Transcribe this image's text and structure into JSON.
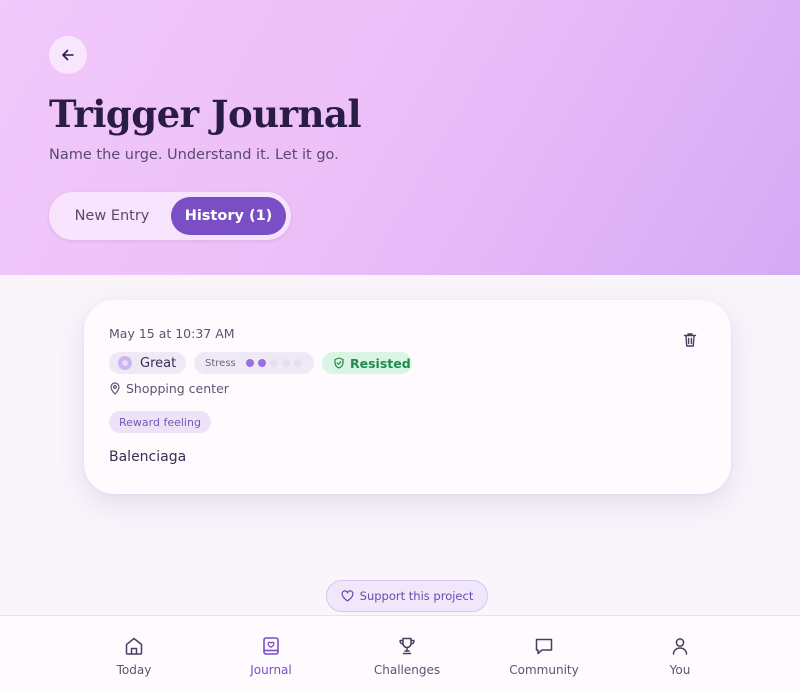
{
  "header": {
    "back_icon": "arrow-left-icon",
    "title": "Trigger Journal",
    "subtitle": "Name the urge. Understand it. Let it go.",
    "tabs": [
      {
        "label": "New Entry",
        "active": false
      },
      {
        "label": "History (1)",
        "active": true
      }
    ]
  },
  "entries": [
    {
      "date": "May 15 at 10:37 AM",
      "mood": "Great",
      "stress_label": "Stress",
      "stress_level": 2,
      "stress_max": 5,
      "outcome": "Resisted",
      "location": "Shopping center",
      "trigger_tag": "Reward feeling",
      "note": "Balenciaga",
      "delete_icon": "trash-icon"
    }
  ],
  "support_label": "Support this project",
  "nav": [
    {
      "label": "Today",
      "icon": "home-icon",
      "active": false
    },
    {
      "label": "Journal",
      "icon": "journal-icon",
      "active": true
    },
    {
      "label": "Challenges",
      "icon": "trophy-icon",
      "active": false
    },
    {
      "label": "Community",
      "icon": "chat-icon",
      "active": false
    },
    {
      "label": "You",
      "icon": "user-icon",
      "active": false
    }
  ],
  "colors": {
    "accent": "#7a4ec4",
    "hero_gradient_start": "#f1c9fb",
    "hero_gradient_end": "#d6a9f4",
    "resisted": "#238a4c"
  }
}
